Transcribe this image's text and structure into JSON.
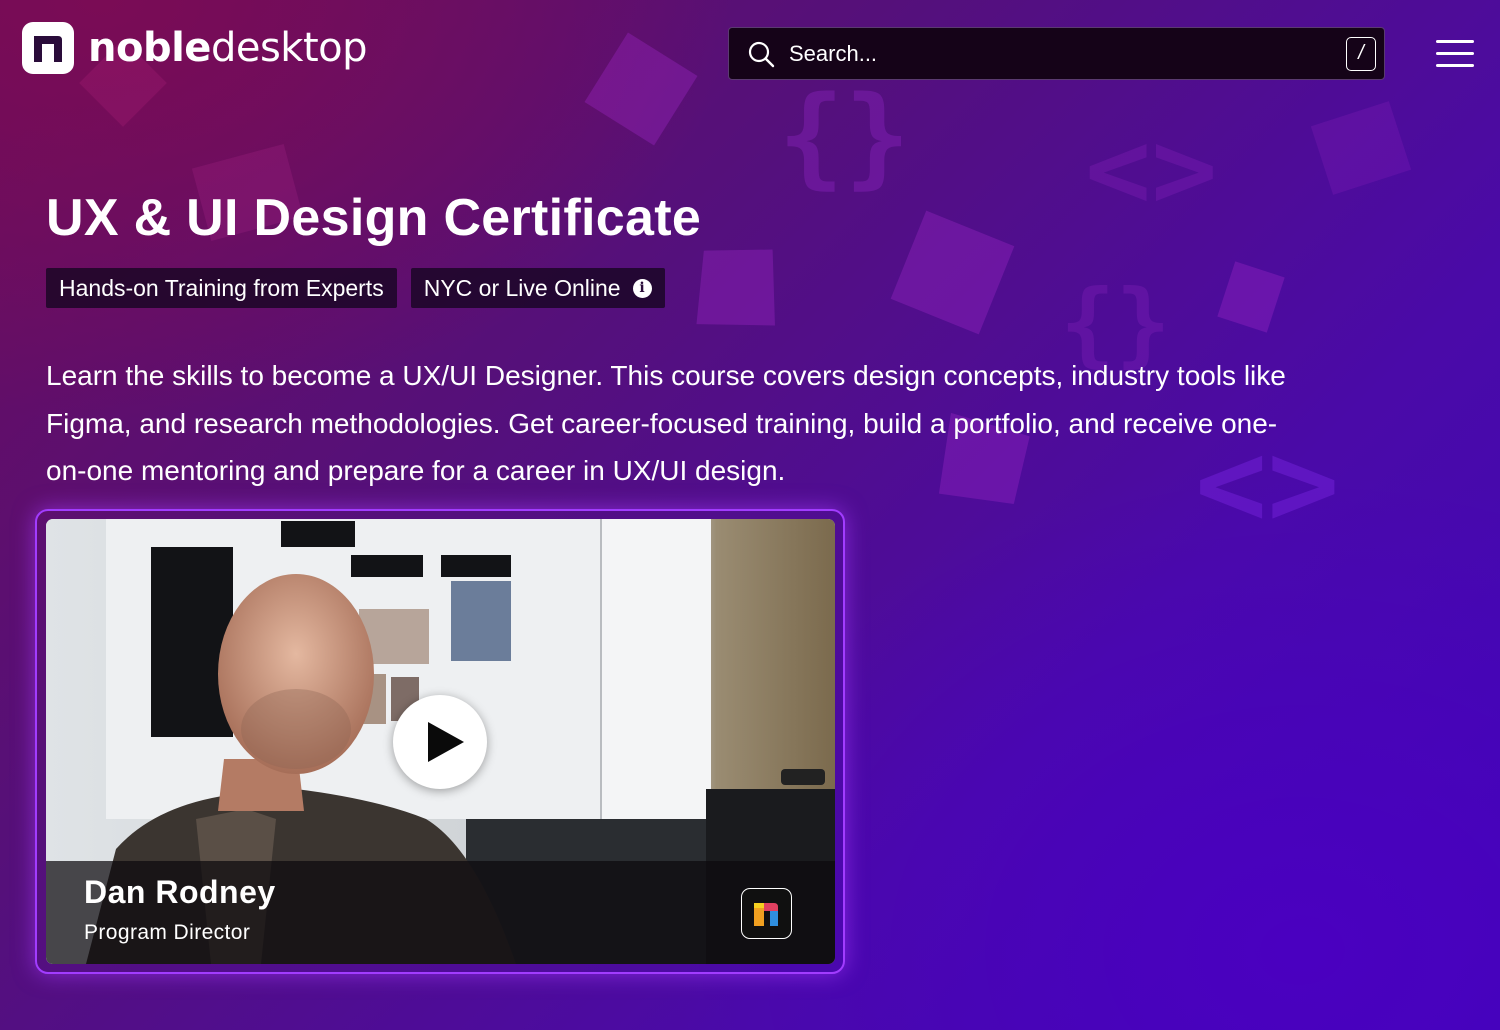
{
  "brand": {
    "name_bold": "noble",
    "name_light": "desktop"
  },
  "search": {
    "placeholder": "Search...",
    "shortcut_key": "/"
  },
  "hero": {
    "title": "UX & UI Design Certificate",
    "tags": [
      "Hands-on Training from Experts",
      "NYC or Live Online"
    ],
    "description": "Learn the skills to become a UX/UI Designer. This course covers design concepts, industry tools like Figma, and research methodologies. Get career-focused training, build a portfolio, and receive one-on-one mentoring and prepare for a career in UX/UI design."
  },
  "video": {
    "presenter_name": "Dan Rodney",
    "presenter_role": "Program Director"
  },
  "icons": {
    "search": "search-icon",
    "menu": "hamburger-menu-icon",
    "info": "info-icon",
    "play": "play-icon",
    "logo": "noble-desktop-logo-icon"
  },
  "colors": {
    "accent": "#a23cff",
    "background_start": "#6a0d5c",
    "background_end": "#3f06b8"
  }
}
